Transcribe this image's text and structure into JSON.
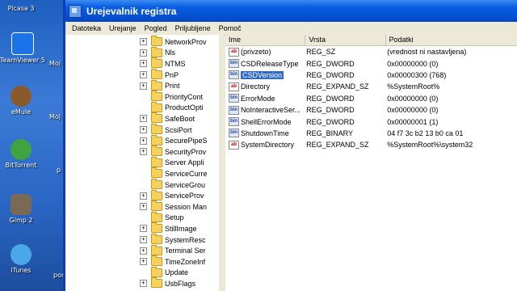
{
  "desktop": {
    "icons": [
      {
        "label": "Picasa 3"
      },
      {
        "label": "TeamViewer 5"
      },
      {
        "label": "eMule"
      },
      {
        "label": "BitTorrent"
      },
      {
        "label": "Gimp 2"
      },
      {
        "label": "iTunes"
      }
    ],
    "partial_labels": [
      "Moj",
      "Moj",
      "p",
      "por"
    ]
  },
  "window": {
    "title": "Urejevalnik registra",
    "menu": [
      "Datoteka",
      "Urejanje",
      "Pogled",
      "Priljubljene",
      "Pomoč"
    ]
  },
  "tree": {
    "items": [
      {
        "label": "NetworkProv",
        "expand": "+"
      },
      {
        "label": "Nls",
        "expand": "+"
      },
      {
        "label": "NTMS",
        "expand": "+"
      },
      {
        "label": "PnP",
        "expand": "+"
      },
      {
        "label": "Print",
        "expand": "+"
      },
      {
        "label": "PriorityCont",
        "expand": ""
      },
      {
        "label": "ProductOpti",
        "expand": ""
      },
      {
        "label": "SafeBoot",
        "expand": "+"
      },
      {
        "label": "ScsiPort",
        "expand": "+"
      },
      {
        "label": "SecurePipeS",
        "expand": "+"
      },
      {
        "label": "SecurityProv",
        "expand": "+"
      },
      {
        "label": "Server Appli",
        "expand": ""
      },
      {
        "label": "ServiceCurre",
        "expand": ""
      },
      {
        "label": "ServiceGrou",
        "expand": ""
      },
      {
        "label": "ServiceProv",
        "expand": "+"
      },
      {
        "label": "Session Man",
        "expand": "+"
      },
      {
        "label": "Setup",
        "expand": ""
      },
      {
        "label": "StillImage",
        "expand": "+"
      },
      {
        "label": "SystemResc",
        "expand": "+"
      },
      {
        "label": "Terminal Ser",
        "expand": "+"
      },
      {
        "label": "TimeZoneInf",
        "expand": "+"
      },
      {
        "label": "Update",
        "expand": ""
      },
      {
        "label": "UsbFlags",
        "expand": "+"
      }
    ]
  },
  "list": {
    "headers": [
      "Ime",
      "Vrsta",
      "Podatki"
    ],
    "rows": [
      {
        "icon": "ab",
        "name": "(privzeto)",
        "type": "REG_SZ",
        "data": "(vrednost ni nastavljena)"
      },
      {
        "icon": "bin",
        "name": "CSDReleaseType",
        "type": "REG_DWORD",
        "data": "0x00000000 (0)"
      },
      {
        "icon": "bin",
        "name": "CSDVersion",
        "type": "REG_DWORD",
        "data": "0x00000300 (768)"
      },
      {
        "icon": "ab",
        "name": "Directory",
        "type": "REG_EXPAND_SZ",
        "data": "%SystemRoot%"
      },
      {
        "icon": "bin",
        "name": "ErrorMode",
        "type": "REG_DWORD",
        "data": "0x00000000 (0)"
      },
      {
        "icon": "bin",
        "name": "NoInteractiveSer...",
        "type": "REG_DWORD",
        "data": "0x00000000 (0)"
      },
      {
        "icon": "bin",
        "name": "ShellErrorMode",
        "type": "REG_DWORD",
        "data": "0x00000001 (1)"
      },
      {
        "icon": "bin",
        "name": "ShutdownTime",
        "type": "REG_BINARY",
        "data": "04 f7 3c b2 13 b0 ca 01"
      },
      {
        "icon": "ab",
        "name": "SystemDirectory",
        "type": "REG_EXPAND_SZ",
        "data": "%SystemRoot%\\system32"
      }
    ],
    "selected_index": 2
  },
  "colors": {
    "titlebar": "#0552d4",
    "selection": "#316ac5",
    "folder": "#f6d25d"
  }
}
